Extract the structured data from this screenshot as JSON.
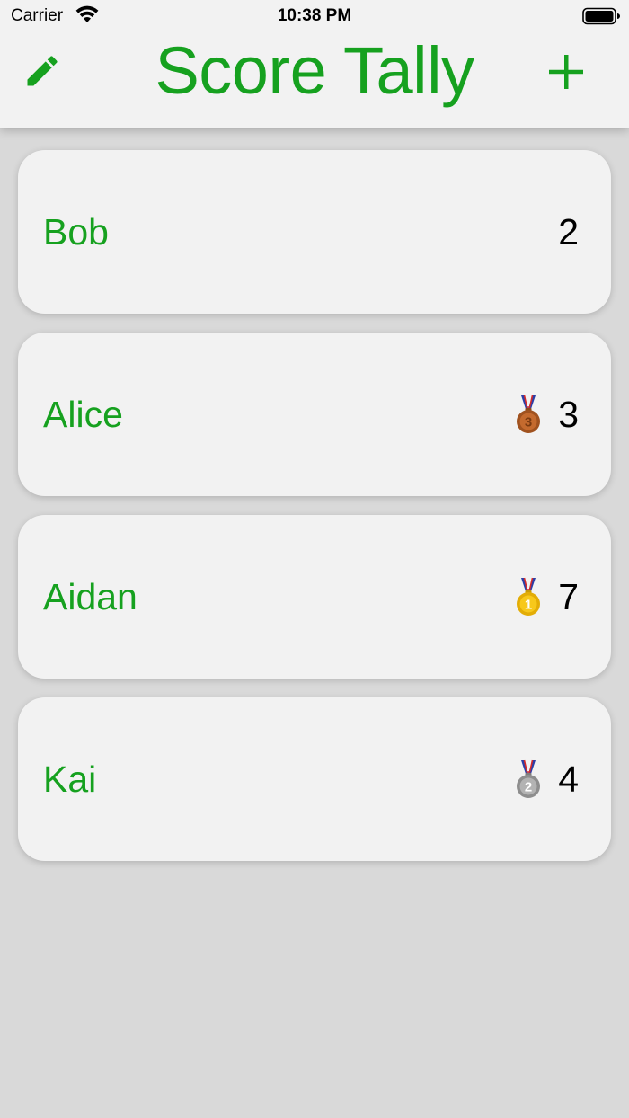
{
  "status_bar": {
    "carrier": "Carrier",
    "time": "10:38 PM"
  },
  "nav": {
    "title": "Score Tally",
    "edit_icon": "pencil-icon",
    "add_icon": "plus-icon"
  },
  "colors": {
    "accent": "#16a11f",
    "background": "#d9d9d9",
    "card": "#f2f2f2"
  },
  "players": [
    {
      "name": "Bob",
      "score": "2",
      "medal": null
    },
    {
      "name": "Alice",
      "score": "3",
      "medal": "bronze-medal-icon"
    },
    {
      "name": "Aidan",
      "score": "7",
      "medal": "gold-medal-icon"
    },
    {
      "name": "Kai",
      "score": "4",
      "medal": "silver-medal-icon"
    }
  ]
}
